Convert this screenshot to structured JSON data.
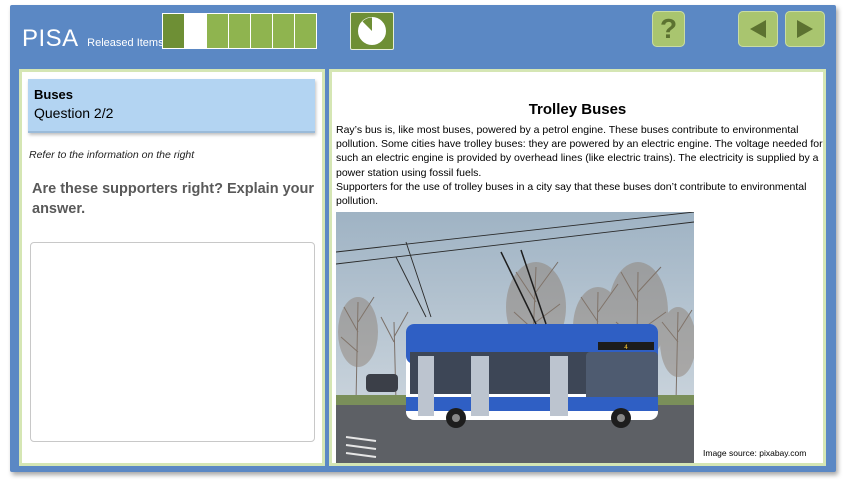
{
  "header": {
    "brand": "PISA",
    "subtitle": "Released Items",
    "progress": {
      "total": 7,
      "current": 2
    },
    "help_label": "?",
    "colors": {
      "bar": "#5b88c4",
      "accent": "#8fb44f",
      "accent_dark": "#6e8f35"
    },
    "icons": [
      "timer-icon",
      "help-icon",
      "back-arrow-icon",
      "forward-arrow-icon"
    ]
  },
  "question_panel": {
    "unit_title": "Buses",
    "question_number": "Question 2/2",
    "instruction": "Refer to the information on the right",
    "prompt": "Are these supporters right? Explain your answer.",
    "answer_value": ""
  },
  "article": {
    "title": "Trolley Buses",
    "paragraph_1": "Ray’s bus is, like most buses, powered by a petrol engine. These buses contribute to environmental pollution. Some cities have trolley buses: they are powered by an electric engine. The voltage needed for such an electric engine is provided by overhead lines (like electric trains). The electricity is supplied by a power station using fossil fuels.",
    "paragraph_2": "Supporters for the use of trolley buses in a city say that these buses don’t contribute to environmental pollution.",
    "image_credit": "Image source: pixabay.com",
    "photo_display": "4"
  }
}
